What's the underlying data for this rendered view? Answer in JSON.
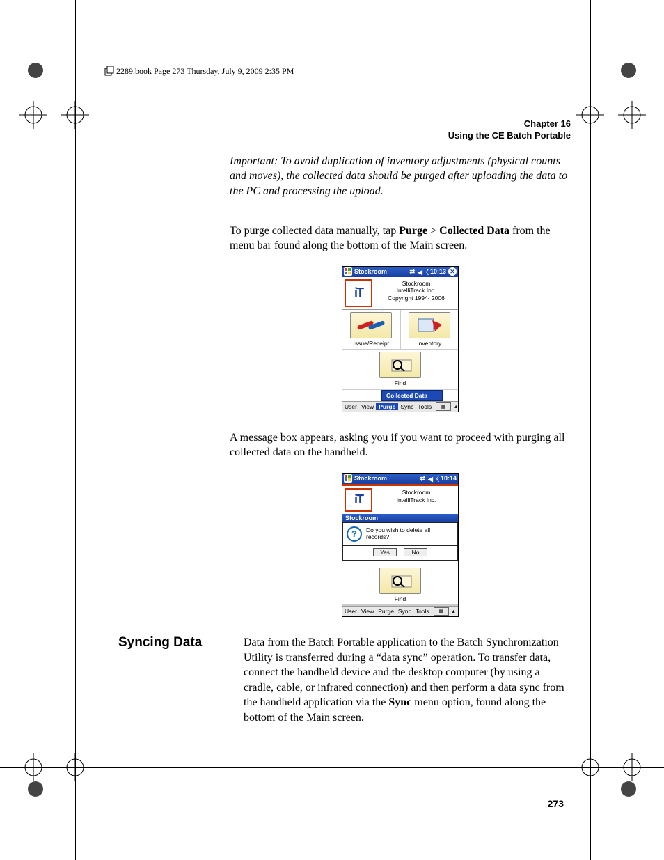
{
  "print_header": "2289.book  Page 273  Thursday, July 9, 2009  2:35 PM",
  "chapter": {
    "line1": "Chapter 16",
    "line2": "Using the CE Batch Portable"
  },
  "important_note": "Important:   To avoid duplication of inventory adjustments (physical counts and moves), the collected data should be purged after uploading the data to the PC and processing the upload.",
  "para_purge": {
    "pre": "To purge collected data manually, tap ",
    "b1": "Purge",
    "mid": " > ",
    "b2": "Collected Data",
    "post": " from the menu bar found along the bottom of the Main screen."
  },
  "screenshot1": {
    "title": "Stockroom",
    "time": "10:13",
    "banner": {
      "line1": "Stockroom",
      "line2": "IntelliTrack Inc.",
      "line3": "Copyright 1994- 2006"
    },
    "icons": {
      "issue": "Issue/Receipt",
      "inventory": "Inventory",
      "find": "Find"
    },
    "popup_item": "Collected Data",
    "menus": [
      "User",
      "View",
      "Purge",
      "Sync",
      "Tools"
    ],
    "selected_menu_index": 2
  },
  "para_msg": "A message box appears, asking you if you want to proceed with purging all collected data on the handheld.",
  "screenshot2": {
    "title": "Stockroom",
    "time": "10:14",
    "banner": {
      "line1": "Stockroom",
      "line2": "IntelliTrack Inc."
    },
    "dialog": {
      "title": "Stockroom",
      "text": "Do you wish to delete all records?",
      "yes": "Yes",
      "no": "No"
    },
    "find": "Find",
    "menus": [
      "User",
      "View",
      "Purge",
      "Sync",
      "Tools"
    ]
  },
  "sync_heading": "Syncing Data",
  "para_sync": {
    "pre": "Data from the Batch Portable application to the Batch Synchronization Utility is transferred during a “data sync” operation. To transfer data, connect the handheld device and the desktop computer (by using a cradle, cable, or infrared connection) and then perform a data sync from the handheld application via the ",
    "b1": "Sync",
    "post": " menu option, found along the bottom of the Main screen."
  },
  "page_number": "273"
}
